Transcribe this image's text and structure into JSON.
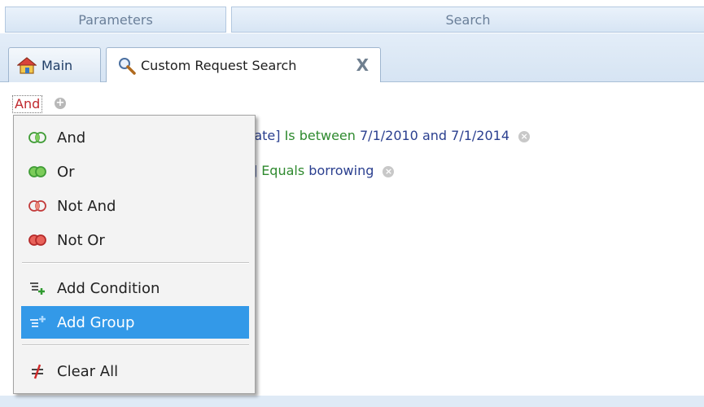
{
  "header": {
    "parameters_label": "Parameters",
    "search_label": "Search"
  },
  "tabs": [
    {
      "label": "Main",
      "icon": "home-icon"
    },
    {
      "label": "Custom Request Search",
      "icon": "search-icon",
      "close": "X",
      "active": true
    }
  ],
  "query": {
    "root_operator": "And",
    "add_symbol": "+",
    "conditions": [
      {
        "field": "Date]",
        "operator": "Is between",
        "value": "7/1/2010 and 7/1/2014"
      },
      {
        "field": "e]",
        "operator": "Equals",
        "value": "borrowing"
      }
    ]
  },
  "menu": {
    "items": [
      {
        "label": "And",
        "icon": "and-circles-icon"
      },
      {
        "label": "Or",
        "icon": "or-circles-icon"
      },
      {
        "label": "Not And",
        "icon": "not-and-circles-icon"
      },
      {
        "label": "Not Or",
        "icon": "not-or-circles-icon"
      },
      {
        "label": "Add Condition",
        "icon": "add-condition-icon"
      },
      {
        "label": "Add Group",
        "icon": "add-group-icon",
        "selected": true
      },
      {
        "label": "Clear All",
        "icon": "clear-all-icon"
      }
    ]
  },
  "colors": {
    "operator_red": "#c0282d",
    "operator_green": "#2f8a2f",
    "value_blue": "#2a3f8f",
    "selection_blue": "#3399e8"
  }
}
